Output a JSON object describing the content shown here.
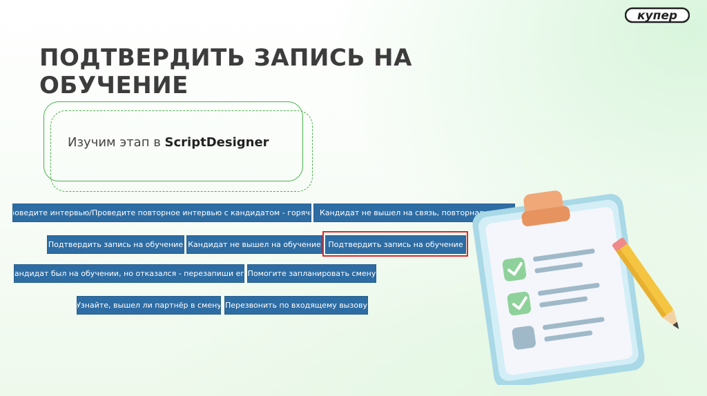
{
  "logo": {
    "text": "купер"
  },
  "slide": {
    "title_line1": "ПОДТВЕРДИТЬ ЗАПИСЬ НА",
    "title_line2": "ОБУЧЕНИЕ",
    "subtitle_prefix": "Изучим этап в ",
    "subtitle_bold": "ScriptDesigner"
  },
  "buttons": [
    "Проведите интервью/Проведите повторное интервью с кандидатом - горячий",
    "Кандидат не вышел на связь, повторная попытка - горячий",
    "Подтвердить запись на обучение",
    "Кандидат не вышел на обучение",
    "Подтвердить запись на обучение",
    "Кандидат был на обучении, но отказался - перезапиши его",
    "Помогите запланировать смену",
    "Узнайте, вышел ли партнёр в смену",
    "Перезвонить по входящему вызову"
  ],
  "illustration": {
    "name": "clipboard-checklist-with-pencil"
  },
  "colors": {
    "title": "#3c3c3c",
    "button": "#2e6da4",
    "highlight": "#e0262d",
    "frame": "#4ab14a"
  }
}
